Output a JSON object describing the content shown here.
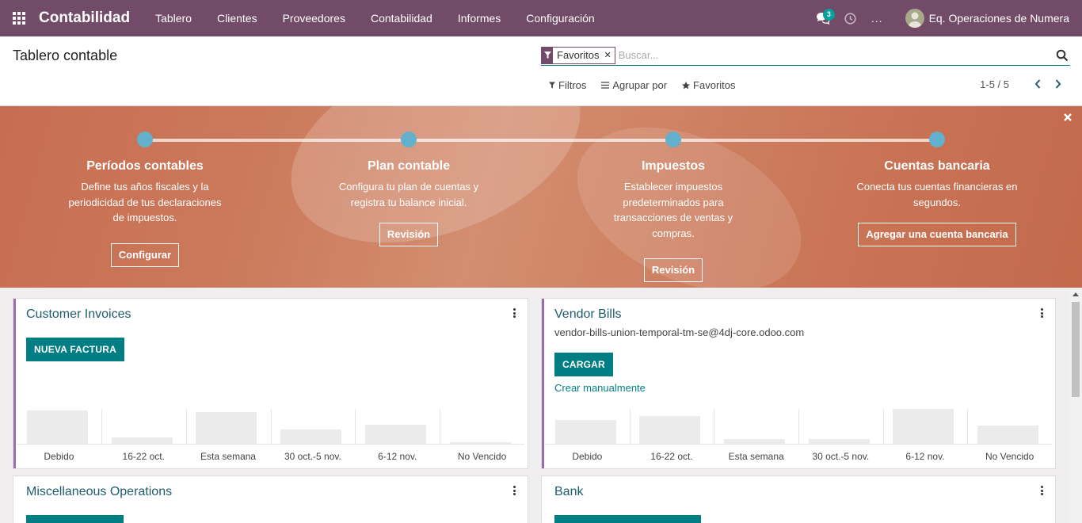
{
  "navbar": {
    "brand": "Contabilidad",
    "menu": [
      "Tablero",
      "Clientes",
      "Proveedores",
      "Contabilidad",
      "Informes",
      "Configuración"
    ],
    "chat_count": "3",
    "more": "...",
    "user": "Eq. Operaciones de Numera"
  },
  "control": {
    "title": "Tablero contable",
    "facet": "Favoritos",
    "search_placeholder": "Buscar...",
    "filters": "Filtros",
    "group_by": "Agrupar por",
    "favorites": "Favoritos",
    "pager": "1-5 / 5"
  },
  "banner": {
    "steps": [
      {
        "title": "Períodos contables",
        "desc": "Define tus años fiscales y la periodicidad de tus declaraciones de impuestos.",
        "button": "Configurar"
      },
      {
        "title": "Plan contable",
        "desc": "Configura tu plan de cuentas y registra tu balance inicial.",
        "button": "Revisión"
      },
      {
        "title": "Impuestos",
        "desc": "Establecer impuestos predeterminados para transacciones de ventas y compras.",
        "button": "Revisión"
      },
      {
        "title": "Cuentas bancaria",
        "desc": "Conecta tus cuentas financieras en segundos.",
        "button": "Agregar una cuenta bancaria"
      }
    ]
  },
  "cards": {
    "customer_invoices": {
      "title": "Customer Invoices",
      "button": "NUEVA FACTURA",
      "chart_labels": [
        "Debido",
        "16-22 oct.",
        "Esta semana",
        "30 oct.-5 nov.",
        "6-12 nov.",
        "No Vencido"
      ],
      "chart_values": [
        0.95,
        0.18,
        0.9,
        0.4,
        0.55,
        0.05
      ]
    },
    "vendor_bills": {
      "title": "Vendor Bills",
      "email": "vendor-bills-union-temporal-tm-se@4dj-core.odoo.com",
      "button": "CARGAR",
      "link": "Crear manualmente",
      "chart_labels": [
        "Debido",
        "16-22 oct.",
        "Esta semana",
        "30 oct.-5 nov.",
        "6-12 nov.",
        "No Vencido"
      ],
      "chart_values": [
        0.68,
        0.8,
        0.13,
        0.13,
        1.0,
        0.52
      ]
    },
    "misc_operations": {
      "title": "Miscellaneous Operations"
    },
    "bank": {
      "title": "Bank"
    }
  },
  "colors": {
    "brand": "#714b67",
    "primary": "#017e84",
    "step_dot": "#62b0cb",
    "card_bar": "#9a6cb0"
  }
}
